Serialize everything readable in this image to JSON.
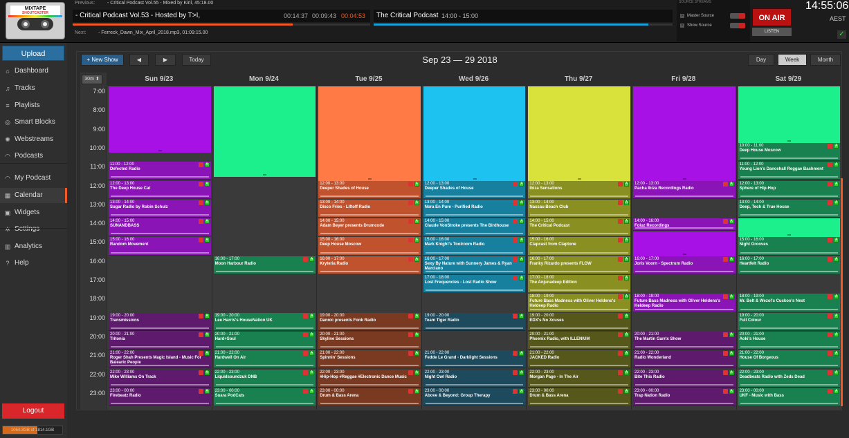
{
  "logo": {
    "text": "MIXTAPE",
    "sub": "SHOUTCASTER"
  },
  "topbar": {
    "previous_label": "Previous:",
    "previous_value": "- Critical Podcast Vol.55 - Mixed by Kiril, 45:18.00",
    "current_show": "- Critical Podcast Vol.53 - Hosted by T>I,",
    "elapsed": "00:14:37",
    "total": "00:09:43",
    "remaining": "00:04:53",
    "current_progress": 0.74,
    "next_label": "Next:",
    "next_value": "- Ferreck_Dawn_Mix_April_2018.mp3, 01:09:15.00",
    "show_name": "The Critical Podcast",
    "show_time": "14:00 - 15:00",
    "show_progress": 0.92,
    "source_streams_label": "SOURCE STREAMS",
    "master_source": "Master Source",
    "show_source": "Show Source",
    "on_air": "ON AIR",
    "listen": "LISTEN",
    "clock": "14:55:06",
    "tz": "AEST",
    "colors": {
      "accent": "#f15a24",
      "on_air": "#bb1111",
      "progress_next": "#1ba0d8"
    }
  },
  "sidebar": {
    "upload": "Upload",
    "items": [
      {
        "label": "Dashboard",
        "icon": "home-icon",
        "glyph": "⌂"
      },
      {
        "label": "Tracks",
        "icon": "music-icon",
        "glyph": "♫"
      },
      {
        "label": "Playlists",
        "icon": "list-icon",
        "glyph": "≡"
      },
      {
        "label": "Smart Blocks",
        "icon": "smart-block-icon",
        "glyph": "◎"
      },
      {
        "label": "Webstreams",
        "icon": "stream-icon",
        "glyph": "✺"
      },
      {
        "label": "Podcasts",
        "icon": "podcast-icon",
        "glyph": "◠"
      },
      {
        "label": "My Podcast",
        "icon": "rss-icon",
        "glyph": "◠"
      },
      {
        "label": "Calendar",
        "icon": "calendar-icon",
        "glyph": "▦"
      },
      {
        "label": "Widgets",
        "icon": "widget-icon",
        "glyph": "▣"
      },
      {
        "label": "Settings",
        "icon": "gear-icon",
        "glyph": "✲"
      },
      {
        "label": "Analytics",
        "icon": "chart-icon",
        "glyph": "▥"
      },
      {
        "label": "Help",
        "icon": "help-icon",
        "glyph": "?"
      }
    ],
    "active": "Calendar",
    "logout": "Logout",
    "disk": "1064.3GB of 1814.1GB",
    "disk_fraction": 0.587
  },
  "calendar": {
    "new_show": "+ New Show",
    "prev": "◀",
    "next": "▶",
    "today": "Today",
    "title": "Sep 23 — 29 2018",
    "views": [
      "Day",
      "Week",
      "Month"
    ],
    "active_view": "Week",
    "slot": "30m ⬍",
    "hours": [
      "7:00",
      "8:00",
      "9:00",
      "10:00",
      "11:00",
      "12:00",
      "13:00",
      "14:00",
      "15:00",
      "16:00",
      "17:00",
      "18:00",
      "19:00",
      "20:00",
      "21:00",
      "22:00",
      "23:00"
    ],
    "days": [
      {
        "label": "Sun 9/23",
        "blocks": [
          {
            "start": 7,
            "end": 10.5,
            "color": "#a711e6"
          }
        ],
        "events": [
          {
            "s": 11,
            "e": 12,
            "time": "11:00 - 12:00",
            "name": "Defected Radio",
            "color": "#8a14b5"
          },
          {
            "s": 12,
            "e": 13,
            "time": "12:00 - 13:00",
            "name": "The Deep House Cat",
            "color": "#8a14b5"
          },
          {
            "s": 13,
            "e": 14,
            "time": "13:00 - 14:00",
            "name": "Sugar Radio by Robin Schulz",
            "color": "#8a14b5"
          },
          {
            "s": 14,
            "e": 15,
            "time": "14:00 - 15:00",
            "name": "SUNANDBASS",
            "color": "#8a14b5"
          },
          {
            "s": 15,
            "e": 16,
            "time": "15:00 - 16:00",
            "name": "Random Movement",
            "color": "#8a14b5"
          },
          {
            "s": 19,
            "e": 20,
            "time": "19:00 - 20:00",
            "name": "Transmissions",
            "color": "#5e1b6e"
          },
          {
            "s": 20,
            "e": 21,
            "time": "20:00 - 21:00",
            "name": "Tritonia",
            "color": "#5e1b6e"
          },
          {
            "s": 21,
            "e": 22,
            "time": "21:00 - 22:00",
            "name": "Roger Shah Presents Magic Island - Music For Balearic People",
            "color": "#5e1b6e"
          },
          {
            "s": 22,
            "e": 23,
            "time": "22:00 - 23:00",
            "name": "Mike Williams On Track",
            "color": "#5e1b6e"
          },
          {
            "s": 23,
            "e": 24,
            "time": "23:00 - 00:00",
            "name": "Firebeatz Radio",
            "color": "#5e1b6e"
          }
        ]
      },
      {
        "label": "Mon 9/24",
        "blocks": [
          {
            "start": 7,
            "end": 11.8,
            "color": "#1bf08c"
          }
        ],
        "events": [
          {
            "s": 16,
            "e": 17,
            "time": "16:00 - 17:00",
            "name": "Moon Harbour Radio",
            "color": "#19804f"
          },
          {
            "s": 19,
            "e": 20,
            "time": "19:00 - 20:00",
            "name": "Lee Harris's HouseNation UK",
            "color": "#19804f"
          },
          {
            "s": 20,
            "e": 21,
            "time": "20:00 - 21:00",
            "name": "Hard+Soul",
            "color": "#19804f"
          },
          {
            "s": 21,
            "e": 22,
            "time": "21:00 - 22:00",
            "name": "Hardwell On Air",
            "color": "#19804f"
          },
          {
            "s": 22,
            "e": 23,
            "time": "22:00 - 23:00",
            "name": "Liquidsoundzuk DNB",
            "color": "#19804f"
          },
          {
            "s": 23,
            "e": 24,
            "time": "23:00 - 00:00",
            "name": "Suara PodCats",
            "color": "#19804f"
          }
        ]
      },
      {
        "label": "Tue 9/25",
        "blocks": [
          {
            "start": 7,
            "end": 12,
            "color": "#ff7a45"
          }
        ],
        "events": [
          {
            "s": 12,
            "e": 13,
            "time": "12:00 - 13:00",
            "name": "Deeper Shades of House",
            "color": "#c0532e"
          },
          {
            "s": 13,
            "e": 14,
            "time": "13:00 - 14:00",
            "name": "Disco Fries - Liftoff Radio",
            "color": "#c0532e"
          },
          {
            "s": 14,
            "e": 15,
            "time": "14:00 - 15:00",
            "name": "Adam Beyer presents Drumcode",
            "color": "#c0532e"
          },
          {
            "s": 15,
            "e": 16,
            "time": "15:00 - 16:00",
            "name": "Deep House Moscow",
            "color": "#c0532e"
          },
          {
            "s": 16,
            "e": 17,
            "time": "16:00 - 17:00",
            "name": "Kryteria Radio",
            "color": "#c0532e"
          },
          {
            "s": 19,
            "e": 20,
            "time": "19:00 - 20:00",
            "name": "Dannic presents Fonk Radio",
            "color": "#7a3a22"
          },
          {
            "s": 20,
            "e": 21,
            "time": "20:00 - 21:00",
            "name": "Skyline Sessions",
            "color": "#7a3a22"
          },
          {
            "s": 21,
            "e": 22,
            "time": "21:00 - 22:00",
            "name": "Spinnin' Sessions",
            "color": "#7a3a22"
          },
          {
            "s": 22,
            "e": 23,
            "time": "22:00 - 23:00",
            "name": "#Hip-Hop #Reggae #Electronic Dance Music",
            "color": "#7a3a22"
          },
          {
            "s": 23,
            "e": 24,
            "time": "23:00 - 00:00",
            "name": "Drum & Bass Arena",
            "color": "#7a3a22"
          }
        ]
      },
      {
        "label": "Wed 9/26",
        "blocks": [
          {
            "start": 7,
            "end": 12,
            "color": "#1ec2f0"
          }
        ],
        "events": [
          {
            "s": 12,
            "e": 13,
            "time": "12:00 - 13:00",
            "name": "Deeper Shades of House",
            "color": "#17809e"
          },
          {
            "s": 13,
            "e": 14,
            "time": "13:00 - 14:00",
            "name": "Nora En Pure - Purified Radio",
            "color": "#17809e"
          },
          {
            "s": 14,
            "e": 15,
            "time": "14:00 - 15:00",
            "name": "Claude VonStroke presents The Birdhouse",
            "color": "#17809e"
          },
          {
            "s": 15,
            "e": 16,
            "time": "15:00 - 16:00",
            "name": "Mark Knight's Toolroom Radio",
            "color": "#17809e"
          },
          {
            "s": 16,
            "e": 17,
            "time": "16:00 - 17:00",
            "name": "Sexy By Nature with Sunnery James & Ryan Marciano",
            "color": "#17809e"
          },
          {
            "s": 17,
            "e": 18,
            "time": "17:00 - 18:00",
            "name": "Lost Frequencies - Lost Radio Show",
            "color": "#17809e"
          },
          {
            "s": 19,
            "e": 20,
            "time": "19:00 - 20:00",
            "name": "Team Tiger Radio",
            "color": "#1d4a5c"
          },
          {
            "s": 21,
            "e": 22,
            "time": "21:00 - 22:00",
            "name": "Fedde Le Grand - Darklight Sessions",
            "color": "#1d4a5c"
          },
          {
            "s": 22,
            "e": 23,
            "time": "22:00 - 23:00",
            "name": "Night Owl Radio",
            "color": "#1d4a5c"
          },
          {
            "s": 23,
            "e": 24,
            "time": "23:00 - 00:00",
            "name": "Above & Beyond: Group Therapy",
            "color": "#1d4a5c"
          }
        ]
      },
      {
        "label": "Thu 9/27",
        "blocks": [
          {
            "start": 7,
            "end": 12,
            "color": "#d9e23a"
          }
        ],
        "events": [
          {
            "s": 12,
            "e": 13,
            "time": "12:00 - 13:00",
            "name": "Ibiza Sensations",
            "color": "#8a8f22"
          },
          {
            "s": 13,
            "e": 14,
            "time": "13:00 - 14:00",
            "name": "Nassau Beach Club",
            "color": "#8a8f22"
          },
          {
            "s": 14,
            "e": 15,
            "time": "14:00 - 15:00",
            "name": "The Critical Podcast",
            "color": "#8a8f22"
          },
          {
            "s": 15,
            "e": 16,
            "time": "15:00 - 16:00",
            "name": "Clapcast from Claptone",
            "color": "#8a8f22"
          },
          {
            "s": 16,
            "e": 17,
            "time": "16:00 - 17:00",
            "name": "Franky Rizardo presents FLOW",
            "color": "#8a8f22"
          },
          {
            "s": 17,
            "e": 18,
            "time": "17:00 - 18:00",
            "name": "The Anjunadeep Edition",
            "color": "#8a8f22"
          },
          {
            "s": 18,
            "e": 19,
            "time": "18:00 - 19:00",
            "name": "Future Bass Madness with Oliver Heldens's Heldeep Radio",
            "color": "#8a8f22"
          },
          {
            "s": 19,
            "e": 20,
            "time": "19:00 - 20:00",
            "name": "EDX's No Xcuses",
            "color": "#55581a"
          },
          {
            "s": 20,
            "e": 21,
            "time": "20:00 - 21:00",
            "name": "Phoenix Radio, with ILLENIUM",
            "color": "#55581a"
          },
          {
            "s": 21,
            "e": 22,
            "time": "21:00 - 22:00",
            "name": "JACKED Radio",
            "color": "#55581a"
          },
          {
            "s": 22,
            "e": 23,
            "time": "22:00 - 23:00",
            "name": "Morgan Page - In The Air",
            "color": "#55581a"
          },
          {
            "s": 23,
            "e": 24,
            "time": "23:00 - 00:00",
            "name": "Drum & Bass Arena",
            "color": "#55581a"
          }
        ]
      },
      {
        "label": "Fri 9/28",
        "blocks": [
          {
            "start": 7,
            "end": 12,
            "color": "#a711e6"
          },
          {
            "start": 14.7,
            "end": 16,
            "color": "#a711e6"
          }
        ],
        "events": [
          {
            "s": 12,
            "e": 13,
            "time": "12:00 - 13:00",
            "name": "Pacha Ibiza Recordings Radio",
            "color": "#8a14b5"
          },
          {
            "s": 14,
            "e": 14.7,
            "time": "14:00 - 16:00",
            "name": "Foluz Recordings",
            "color": "#8a14b5"
          },
          {
            "s": 16,
            "e": 17,
            "time": "16:00 - 17:00",
            "name": "Joris Voorn - Spectrum Radio",
            "color": "#8a14b5"
          },
          {
            "s": 18,
            "e": 19,
            "time": "18:00 - 19:00",
            "name": "Future Bass Madness with Oliver Heldens's Heldeep Radio",
            "color": "#8a14b5"
          },
          {
            "s": 20,
            "e": 21,
            "time": "20:00 - 21:00",
            "name": "The Martin Garrix Show",
            "color": "#5e1b6e"
          },
          {
            "s": 21,
            "e": 22,
            "time": "21:00 - 22:00",
            "name": "Radio Wonderland",
            "color": "#5e1b6e"
          },
          {
            "s": 22,
            "e": 23,
            "time": "22:00 - 23:00",
            "name": "Bite This Radio",
            "color": "#5e1b6e"
          },
          {
            "s": 23,
            "e": 24,
            "time": "23:00 - 00:00",
            "name": "Trap Nation Radio",
            "color": "#5e1b6e"
          }
        ]
      },
      {
        "label": "Sat 9/29",
        "blocks": [
          {
            "start": 7,
            "end": 10,
            "color": "#1bf08c"
          },
          {
            "start": 14,
            "end": 15,
            "color": "#1bf08c"
          }
        ],
        "events": [
          {
            "s": 10,
            "e": 11,
            "time": "10:00 - 11:00",
            "name": "Deep House Moscow",
            "color": "#19804f"
          },
          {
            "s": 11,
            "e": 12,
            "time": "11:00 - 12:00",
            "name": "Young Lion's Dancehall Reggae Bashment",
            "color": "#19804f"
          },
          {
            "s": 12,
            "e": 13,
            "time": "12:00 - 13:00",
            "name": "Sphere of Hip-Hop",
            "color": "#19804f"
          },
          {
            "s": 13,
            "e": 14,
            "time": "13:00 - 14:00",
            "name": "Deep, Tech & True House",
            "color": "#19804f"
          },
          {
            "s": 15,
            "e": 16,
            "time": "15:00 - 16:00",
            "name": "Night Grooves",
            "color": "#19804f"
          },
          {
            "s": 16,
            "e": 17,
            "time": "16:00 - 17:00",
            "name": "Heartfelt Radio",
            "color": "#19804f"
          },
          {
            "s": 18,
            "e": 19,
            "time": "18:00 - 19:00",
            "name": "Mr. Belt & Wezol's Cuckoo's Nest",
            "color": "#19804f"
          },
          {
            "s": 19,
            "e": 20,
            "time": "19:00 - 20:00",
            "name": "Full Colour",
            "color": "#19804f"
          },
          {
            "s": 20,
            "e": 21,
            "time": "20:00 - 21:00",
            "name": "Aoki's House",
            "color": "#19804f"
          },
          {
            "s": 21,
            "e": 22,
            "time": "21:00 - 22:00",
            "name": "House Of Borgeous",
            "color": "#19804f"
          },
          {
            "s": 22,
            "e": 23,
            "time": "22:00 - 23:00",
            "name": "Deadbeats Radio with Zeds Dead",
            "color": "#19804f"
          },
          {
            "s": 23,
            "e": 24,
            "time": "23:00 - 00:00",
            "name": "UKF - Music with Bass",
            "color": "#19804f"
          }
        ]
      }
    ]
  }
}
